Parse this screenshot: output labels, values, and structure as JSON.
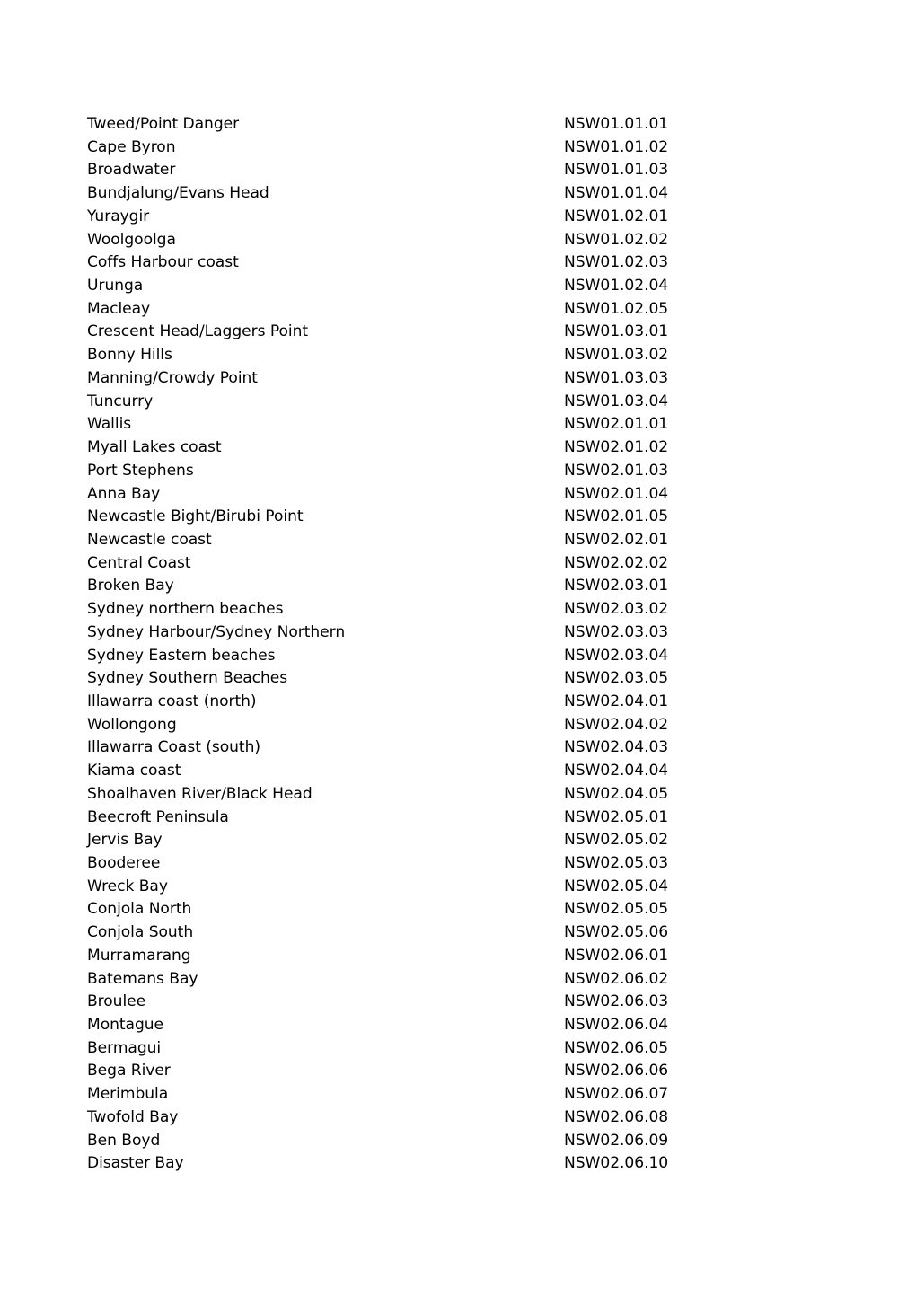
{
  "document": {
    "page_background": "#ffffff",
    "text_color": "#000000",
    "columns": {
      "name_header": "",
      "code_header": ""
    },
    "rows": [
      {
        "name": "Tweed/Point Danger",
        "code": "NSW01.01.01"
      },
      {
        "name": "Cape Byron",
        "code": "NSW01.01.02"
      },
      {
        "name": "Broadwater",
        "code": "NSW01.01.03"
      },
      {
        "name": "Bundjalung/Evans Head",
        "code": "NSW01.01.04"
      },
      {
        "name": "Yuraygir",
        "code": "NSW01.02.01"
      },
      {
        "name": "Woolgoolga",
        "code": "NSW01.02.02"
      },
      {
        "name": "Coffs Harbour coast",
        "code": "NSW01.02.03"
      },
      {
        "name": "Urunga",
        "code": "NSW01.02.04"
      },
      {
        "name": "Macleay",
        "code": "NSW01.02.05"
      },
      {
        "name": "Crescent Head/Laggers Point",
        "code": "NSW01.03.01"
      },
      {
        "name": "Bonny Hills",
        "code": "NSW01.03.02"
      },
      {
        "name": "Manning/Crowdy Point",
        "code": "NSW01.03.03"
      },
      {
        "name": "Tuncurry",
        "code": "NSW01.03.04"
      },
      {
        "name": "Wallis",
        "code": "NSW02.01.01"
      },
      {
        "name": "Myall Lakes coast",
        "code": "NSW02.01.02"
      },
      {
        "name": "Port Stephens",
        "code": "NSW02.01.03"
      },
      {
        "name": "Anna Bay",
        "code": "NSW02.01.04"
      },
      {
        "name": "Newcastle Bight/Birubi Point",
        "code": "NSW02.01.05"
      },
      {
        "name": "Newcastle coast",
        "code": "NSW02.02.01"
      },
      {
        "name": "Central Coast",
        "code": "NSW02.02.02"
      },
      {
        "name": "Broken Bay",
        "code": "NSW02.03.01"
      },
      {
        "name": "Sydney northern beaches",
        "code": "NSW02.03.02"
      },
      {
        "name": "Sydney Harbour/Sydney Northern",
        "code": "NSW02.03.03"
      },
      {
        "name": "Sydney Eastern beaches",
        "code": "NSW02.03.04"
      },
      {
        "name": "Sydney Southern Beaches",
        "code": "NSW02.03.05"
      },
      {
        "name": "Illawarra coast (north)",
        "code": "NSW02.04.01"
      },
      {
        "name": "Wollongong",
        "code": "NSW02.04.02"
      },
      {
        "name": "Illawarra Coast (south)",
        "code": "NSW02.04.03"
      },
      {
        "name": "Kiama coast",
        "code": "NSW02.04.04"
      },
      {
        "name": "Shoalhaven River/Black Head",
        "code": "NSW02.04.05"
      },
      {
        "name": "Beecroft Peninsula",
        "code": "NSW02.05.01"
      },
      {
        "name": "Jervis Bay",
        "code": "NSW02.05.02"
      },
      {
        "name": "Booderee",
        "code": "NSW02.05.03"
      },
      {
        "name": "Wreck Bay",
        "code": "NSW02.05.04"
      },
      {
        "name": "Conjola North",
        "code": "NSW02.05.05"
      },
      {
        "name": "Conjola South",
        "code": "NSW02.05.06"
      },
      {
        "name": "Murramarang",
        "code": "NSW02.06.01"
      },
      {
        "name": "Batemans Bay",
        "code": "NSW02.06.02"
      },
      {
        "name": "Broulee",
        "code": "NSW02.06.03"
      },
      {
        "name": "Montague",
        "code": "NSW02.06.04"
      },
      {
        "name": "Bermagui",
        "code": "NSW02.06.05"
      },
      {
        "name": "Bega River",
        "code": "NSW02.06.06"
      },
      {
        "name": "Merimbula",
        "code": "NSW02.06.07"
      },
      {
        "name": "Twofold Bay",
        "code": "NSW02.06.08"
      },
      {
        "name": "Ben Boyd",
        "code": "NSW02.06.09"
      },
      {
        "name": "Disaster Bay",
        "code": "NSW02.06.10"
      }
    ]
  }
}
